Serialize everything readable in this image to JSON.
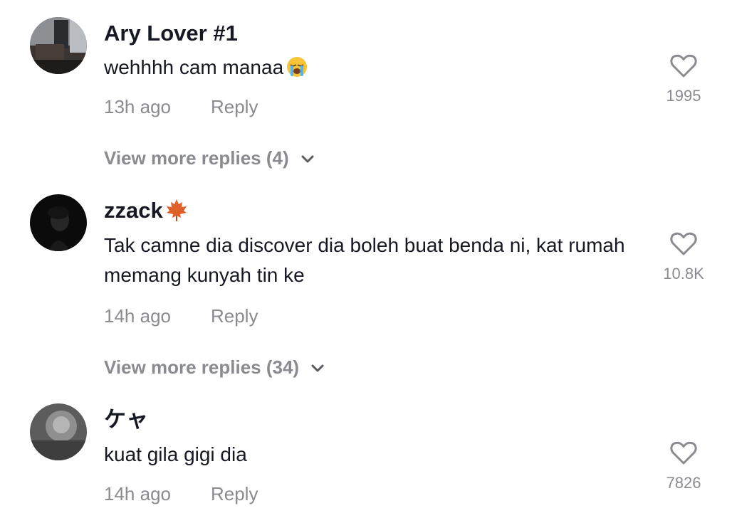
{
  "comments": [
    {
      "username": "Ary Lover #1",
      "text": "wehhhh cam manaa",
      "emoji": "loudly-crying-face",
      "time": "13h ago",
      "reply_label": "Reply",
      "likes": "1995",
      "view_more": "View more replies (4)"
    },
    {
      "username": "zzack",
      "username_emoji": "maple-leaf",
      "text": "Tak camne dia discover dia boleh buat benda ni, kat rumah memang kunyah tin ke",
      "time": "14h ago",
      "reply_label": "Reply",
      "likes": "10.8K",
      "view_more": "View more replies (34)"
    },
    {
      "username": "ケャ",
      "text": "kuat gila gigi dia",
      "time": "14h ago",
      "reply_label": "Reply",
      "likes": "7826"
    }
  ],
  "icons": {
    "like": "heart-outline-icon",
    "expand": "chevron-down-icon"
  },
  "colors": {
    "text": "#161823",
    "secondary": "#8a8b91"
  }
}
